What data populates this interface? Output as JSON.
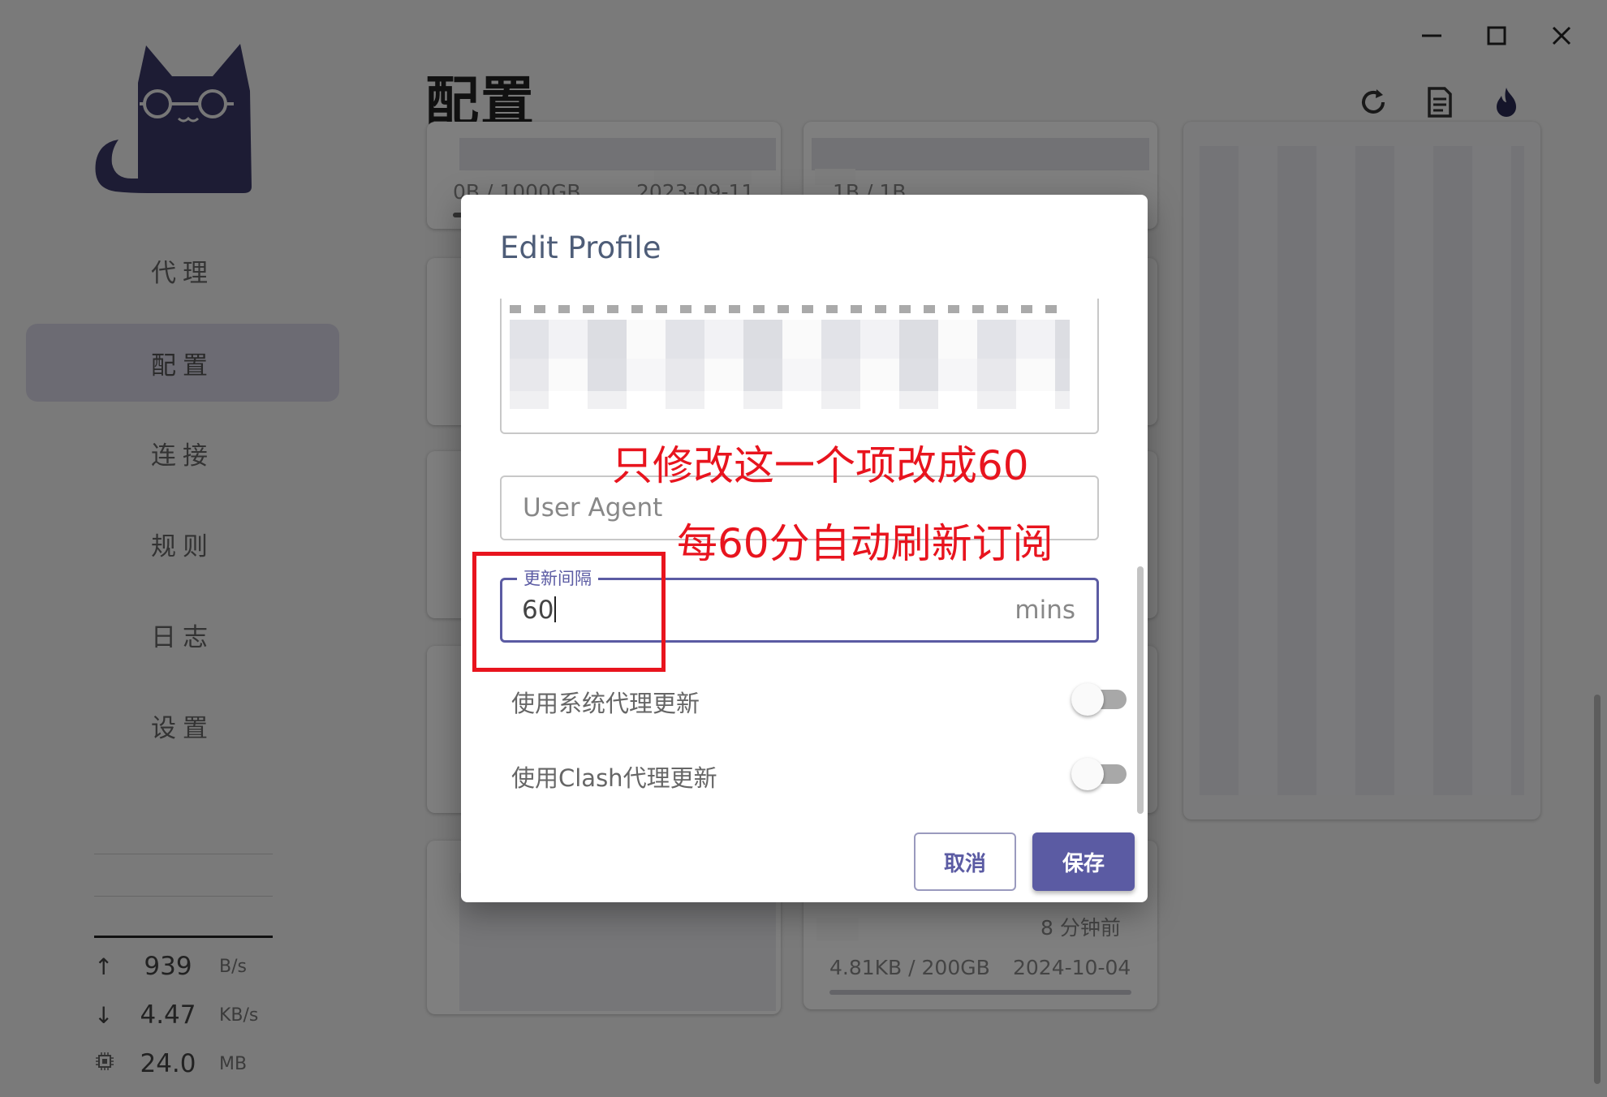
{
  "app": {
    "page_title": "配置",
    "nav": [
      {
        "label": "代理",
        "active": false
      },
      {
        "label": "配置",
        "active": true
      },
      {
        "label": "连接",
        "active": false
      },
      {
        "label": "规则",
        "active": false
      },
      {
        "label": "日志",
        "active": false
      },
      {
        "label": "设置",
        "active": false
      }
    ],
    "traffic": {
      "upload": {
        "value": "939",
        "unit": "B/s",
        "icon": "arrow-up-icon"
      },
      "download": {
        "value": "4.47",
        "unit": "KB/s",
        "icon": "arrow-down-icon"
      },
      "memory": {
        "value": "24.0",
        "unit": "MB",
        "icon": "memory-chip-icon"
      }
    },
    "header_icons": [
      "refresh-icon",
      "document-icon",
      "flame-icon"
    ],
    "window_controls": [
      "minimize-icon",
      "maximize-icon",
      "close-icon"
    ],
    "background_cards": [
      {
        "usage": "0B / 1000GB",
        "date": "2023-09-11"
      },
      {
        "usage": "1B / 1B"
      },
      {
        "time_ago": "8 分钟前",
        "usage": "4.81KB / 200GB",
        "date": "2024-10-04"
      }
    ]
  },
  "dialog": {
    "title": "Edit Profile",
    "user_agent": {
      "placeholder": "User Agent",
      "value": ""
    },
    "update_interval": {
      "label": "更新间隔",
      "value": "60",
      "suffix": "mins"
    },
    "toggles": [
      {
        "label": "使用系统代理更新",
        "checked": false
      },
      {
        "label": "使用Clash代理更新",
        "checked": false
      }
    ],
    "buttons": {
      "cancel": "取消",
      "save": "保存"
    }
  },
  "annotations": {
    "line1": "只修改这一个项改成60",
    "line2": "每60分自动刷新订阅",
    "color": "#e8141e"
  },
  "colors": {
    "accent": "#5b5ba3",
    "nav_active_bg": "#d8d7e6",
    "logo": "#3a3868"
  }
}
